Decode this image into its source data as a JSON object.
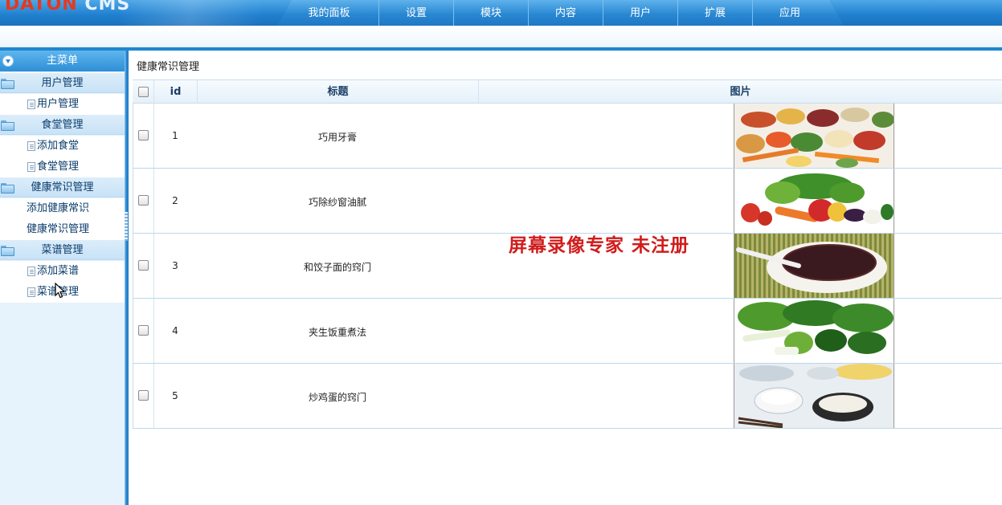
{
  "header": {
    "logo_part1": "DATON",
    "logo_part2": "CMS",
    "nav": [
      "我的面板",
      "设置",
      "模块",
      "内容",
      "用户",
      "扩展",
      "应用"
    ]
  },
  "sidebar": {
    "main_menu": "主菜单",
    "groups": [
      {
        "title": "用户管理",
        "items": [
          "用户管理"
        ]
      },
      {
        "title": "食堂管理",
        "items": [
          "添加食堂",
          "食堂管理"
        ]
      },
      {
        "title": "健康常识管理",
        "items": [
          "添加健康常识",
          "健康常识管理"
        ]
      },
      {
        "title": "菜谱管理",
        "items": [
          "添加菜谱",
          "菜谱管理"
        ]
      }
    ]
  },
  "main": {
    "breadcrumb": "健康常识管理",
    "columns": [
      "id",
      "标题",
      "图片"
    ],
    "rows": [
      {
        "id": "1",
        "title": "巧用牙膏",
        "image": "vegetables-assortment"
      },
      {
        "id": "2",
        "title": "巧除纱窗油腻",
        "image": "fresh-vegetables"
      },
      {
        "id": "3",
        "title": "和饺子面的窍门",
        "image": "porridge-bowl"
      },
      {
        "id": "4",
        "title": "夹生饭重煮法",
        "image": "leafy-greens"
      },
      {
        "id": "5",
        "title": "炒鸡蛋的窍门",
        "image": "meal-table"
      }
    ]
  },
  "watermark": "屏幕录像专家  未注册",
  "colors": {
    "accent": "#1f86cf",
    "sidebar_bg": "#e6f3fc",
    "watermark": "#d01c1c"
  }
}
